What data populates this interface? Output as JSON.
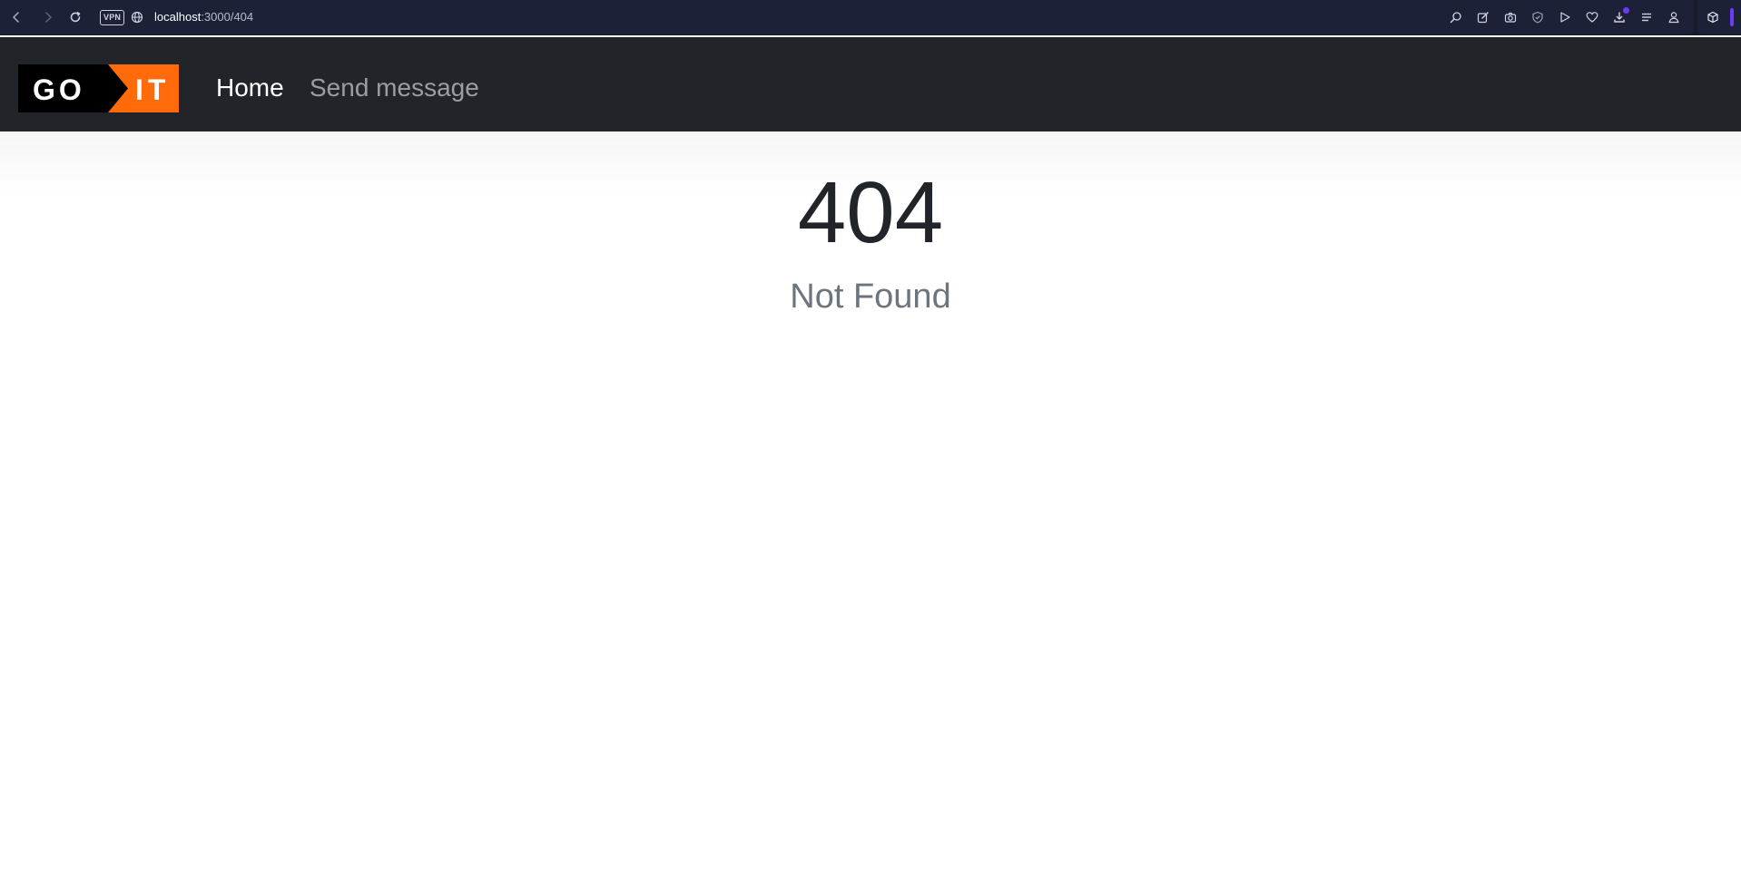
{
  "browser": {
    "vpn_label": "VPN",
    "url_host": "localhost",
    "url_path": ":3000/404",
    "icons": [
      "back-icon",
      "forward-icon",
      "reload-icon",
      "globe-icon",
      "search-icon",
      "edit-icon",
      "camera-icon",
      "shield-icon",
      "play-icon",
      "heart-icon",
      "download-icon",
      "menu-icon",
      "profile-icon",
      "box-icon"
    ],
    "accent_color": "#6a3df5"
  },
  "navbar": {
    "logo_left": "GO",
    "logo_right": "IT",
    "logo_accent": "#ff6b0a",
    "links": [
      {
        "label": "Home",
        "active": true
      },
      {
        "label": "Send message",
        "active": false
      }
    ]
  },
  "main": {
    "code": "404",
    "message": "Not Found"
  }
}
